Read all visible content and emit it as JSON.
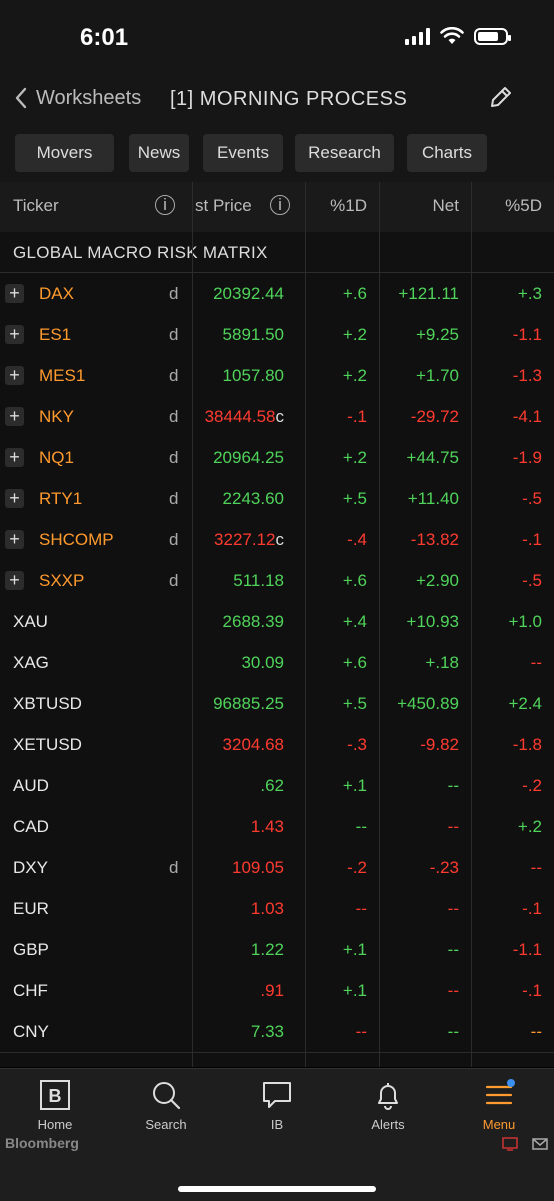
{
  "status": {
    "time": "6:01"
  },
  "nav": {
    "back_label": "Worksheets",
    "title": "[1] MORNING PROCESS"
  },
  "tabs": [
    "Movers",
    "News",
    "Events",
    "Research",
    "Charts"
  ],
  "columns": {
    "ticker": "Ticker",
    "price": "st Price",
    "pct1d": "%1D",
    "net": "Net",
    "pct5d": "%5D"
  },
  "section_title": "GLOBAL MACRO RISK MATRIX",
  "colors": {
    "green": "#4fd35a",
    "red": "#ff3b30",
    "orange": "#ff9a2e",
    "ticker_orange": "#ff9a2e",
    "white": "#e8e8e8",
    "accent": "#ff9a2e"
  },
  "rows": [
    {
      "ticker": "DAX",
      "expand": true,
      "d": "d",
      "price": "20392.44",
      "price_suffix": "",
      "pct1d": "+.6",
      "net": "+121.11",
      "pct5d": "+.3",
      "pc": "green",
      "c1": "green",
      "cn": "green",
      "c5": "green"
    },
    {
      "ticker": "ES1",
      "expand": true,
      "d": "d",
      "price": "5891.50",
      "price_suffix": "",
      "pct1d": "+.2",
      "net": "+9.25",
      "pct5d": "-1.1",
      "pc": "green",
      "c1": "green",
      "cn": "green",
      "c5": "red"
    },
    {
      "ticker": "MES1",
      "expand": true,
      "d": "d",
      "price": "1057.80",
      "price_suffix": "",
      "pct1d": "+.2",
      "net": "+1.70",
      "pct5d": "-1.3",
      "pc": "green",
      "c1": "green",
      "cn": "green",
      "c5": "red"
    },
    {
      "ticker": "NKY",
      "expand": true,
      "d": "d",
      "price": "38444.58",
      "price_suffix": "c",
      "pct1d": "-.1",
      "net": "-29.72",
      "pct5d": "-4.1",
      "pc": "red",
      "c1": "red",
      "cn": "red",
      "c5": "red"
    },
    {
      "ticker": "NQ1",
      "expand": true,
      "d": "d",
      "price": "20964.25",
      "price_suffix": "",
      "pct1d": "+.2",
      "net": "+44.75",
      "pct5d": "-1.9",
      "pc": "green",
      "c1": "green",
      "cn": "green",
      "c5": "red"
    },
    {
      "ticker": "RTY1",
      "expand": true,
      "d": "d",
      "price": "2243.60",
      "price_suffix": "",
      "pct1d": "+.5",
      "net": "+11.40",
      "pct5d": "-.5",
      "pc": "green",
      "c1": "green",
      "cn": "green",
      "c5": "red"
    },
    {
      "ticker": "SHCOMP",
      "expand": true,
      "d": "d",
      "price": "3227.12",
      "price_suffix": "c",
      "pct1d": "-.4",
      "net": "-13.82",
      "pct5d": "-.1",
      "pc": "red",
      "c1": "red",
      "cn": "red",
      "c5": "red"
    },
    {
      "ticker": "SXXP",
      "expand": true,
      "d": "d",
      "price": "511.18",
      "price_suffix": "",
      "pct1d": "+.6",
      "net": "+2.90",
      "pct5d": "-.5",
      "pc": "green",
      "c1": "green",
      "cn": "green",
      "c5": "red"
    },
    {
      "ticker": "XAU",
      "expand": false,
      "d": "",
      "price": "2688.39",
      "price_suffix": "",
      "pct1d": "+.4",
      "net": "+10.93",
      "pct5d": "+1.0",
      "pc": "green",
      "c1": "green",
      "cn": "green",
      "c5": "green"
    },
    {
      "ticker": "XAG",
      "expand": false,
      "d": "",
      "price": "30.09",
      "price_suffix": "",
      "pct1d": "+.6",
      "net": "+.18",
      "pct5d": "--",
      "pc": "green",
      "c1": "green",
      "cn": "green",
      "c5": "red"
    },
    {
      "ticker": "XBTUSD",
      "expand": false,
      "d": "",
      "price": "96885.25",
      "price_suffix": "",
      "pct1d": "+.5",
      "net": "+450.89",
      "pct5d": "+2.4",
      "pc": "green",
      "c1": "green",
      "cn": "green",
      "c5": "green"
    },
    {
      "ticker": "XETUSD",
      "expand": false,
      "d": "",
      "price": "3204.68",
      "price_suffix": "",
      "pct1d": "-.3",
      "net": "-9.82",
      "pct5d": "-1.8",
      "pc": "red",
      "c1": "red",
      "cn": "red",
      "c5": "red"
    },
    {
      "ticker": "AUD",
      "expand": false,
      "d": "",
      "price": ".62",
      "price_suffix": "",
      "pct1d": "+.1",
      "net": "--",
      "pct5d": "-.2",
      "pc": "green",
      "c1": "green",
      "cn": "green",
      "c5": "red"
    },
    {
      "ticker": "CAD",
      "expand": false,
      "d": "",
      "price": "1.43",
      "price_suffix": "",
      "pct1d": "--",
      "net": "--",
      "pct5d": "+.2",
      "pc": "red",
      "c1": "green",
      "cn": "red",
      "c5": "green"
    },
    {
      "ticker": "DXY",
      "expand": false,
      "d": "d",
      "price": "109.05",
      "price_suffix": "",
      "pct1d": "-.2",
      "net": "-.23",
      "pct5d": "--",
      "pc": "red",
      "c1": "red",
      "cn": "red",
      "c5": "red"
    },
    {
      "ticker": "EUR",
      "expand": false,
      "d": "",
      "price": "1.03",
      "price_suffix": "",
      "pct1d": "--",
      "net": "--",
      "pct5d": "-.1",
      "pc": "red",
      "c1": "red",
      "cn": "red",
      "c5": "red"
    },
    {
      "ticker": "GBP",
      "expand": false,
      "d": "",
      "price": "1.22",
      "price_suffix": "",
      "pct1d": "+.1",
      "net": "--",
      "pct5d": "-1.1",
      "pc": "green",
      "c1": "green",
      "cn": "green",
      "c5": "red"
    },
    {
      "ticker": "CHF",
      "expand": false,
      "d": "",
      "price": ".91",
      "price_suffix": "",
      "pct1d": "+.1",
      "net": "--",
      "pct5d": "-.1",
      "pc": "red",
      "c1": "green",
      "cn": "red",
      "c5": "red"
    },
    {
      "ticker": "CNY",
      "expand": false,
      "d": "",
      "price": "7.33",
      "price_suffix": "",
      "pct1d": "--",
      "net": "--",
      "pct5d": "--",
      "pc": "green",
      "c1": "red",
      "cn": "green",
      "c5": "orange"
    }
  ],
  "bottom_nav": [
    {
      "label": "Home",
      "icon": "bloomberg-b-icon"
    },
    {
      "label": "Search",
      "icon": "search-icon"
    },
    {
      "label": "IB",
      "icon": "chat-bubble-icon"
    },
    {
      "label": "Alerts",
      "icon": "bell-icon"
    },
    {
      "label": "Menu",
      "icon": "menu-icon"
    }
  ],
  "brand": "Bloomberg"
}
